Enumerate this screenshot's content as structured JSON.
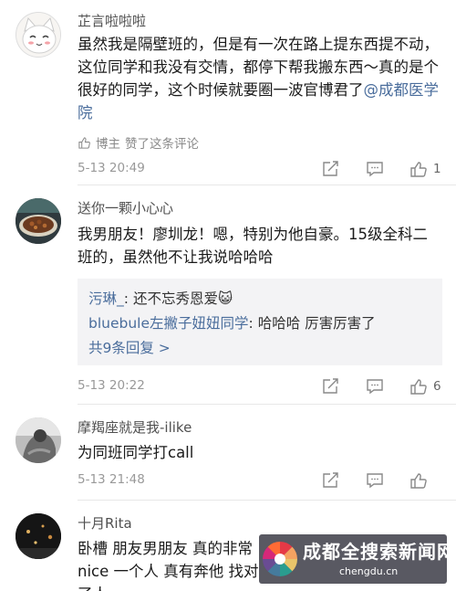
{
  "comments": [
    {
      "username": "芷言啦啦啦",
      "text": "虽然我是隔壁班的，但是有一次在路上提东西提不动，这位同学和我没有交情，都停下帮我搬东西～真的是个很好的同学，这个时候就要圈一波官博君了",
      "mention": "@成都医学院",
      "liked_by_author_label": "博主",
      "liked_by_author_text": "赞了这条评论",
      "timestamp": "5-13 20:49",
      "like_count": "1"
    },
    {
      "username": "送你一颗小心心",
      "text": "我男朋友！廖圳龙！嗯，特别为他自豪。15级全科二班的，虽然他不让我说哈哈哈",
      "replies": [
        {
          "name": "污琳_",
          "sep": ":",
          "text": "还不忘秀恩爱😺"
        },
        {
          "name": "bluebule左撇子妞妞同学",
          "sep": ":",
          "text": "哈哈哈 厉害厉害了"
        }
      ],
      "more_replies": "共9条回复 >",
      "timestamp": "5-13 20:22",
      "like_count": "6"
    },
    {
      "username": "摩羯座就是我-ilike",
      "text": "为同班同学打call",
      "timestamp": "5-13 21:48",
      "like_count": ""
    },
    {
      "username": "十月Rita",
      "text": "卧槽 朋友男朋友 真的非常nice 一个人 真有奔他 找对了人"
    }
  ],
  "watermark": {
    "title": "成都全搜索新闻网",
    "url": "chengdu.cn"
  },
  "icons": {
    "share": "share-icon",
    "reply": "comment-icon",
    "like": "thumbs-up-icon"
  }
}
